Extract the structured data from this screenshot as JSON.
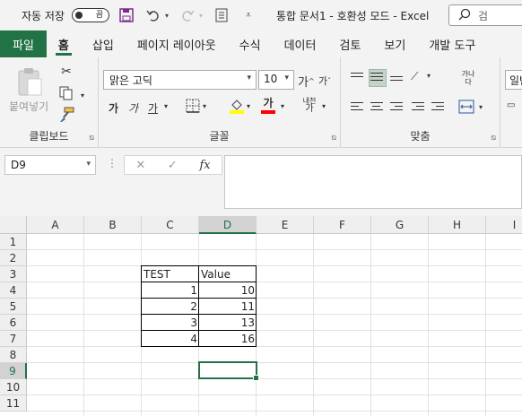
{
  "titlebar": {
    "autosave_label": "자동 저장",
    "autosave_state": "끔",
    "doc_title": "통합 문서1  -  호환성 모드  -  Excel",
    "search_placeholder": "검"
  },
  "tabs": [
    "파일",
    "홈",
    "삽입",
    "페이지 레이아웃",
    "수식",
    "데이터",
    "검토",
    "보기",
    "개발 도구"
  ],
  "ribbon": {
    "clipboard": {
      "paste_label": "붙여넣기",
      "group_label": "클립보드"
    },
    "font": {
      "font_name": "맑은 고딕",
      "font_size": "10",
      "grow_label": "가",
      "shrink_label": "가",
      "bold_label": "가",
      "italic_label": "가",
      "underline_label": "가",
      "font_color_label": "가",
      "phonetic_label": "내천",
      "group_label": "글꼴",
      "fill_color": "#ffff00",
      "font_color": "#ff0000"
    },
    "alignment": {
      "wrap_label": "가나 다",
      "group_label": "맞춤"
    },
    "number": {
      "format_value": "일반"
    }
  },
  "formula_bar": {
    "name_box": "D9",
    "cancel_icon": "close-icon",
    "enter_icon": "check-icon",
    "fx_label": "fx",
    "formula": ""
  },
  "sheet": {
    "columns": [
      "A",
      "B",
      "C",
      "D",
      "E",
      "F",
      "G",
      "H",
      "I"
    ],
    "rows": [
      "1",
      "2",
      "3",
      "4",
      "5",
      "6",
      "7",
      "8",
      "9",
      "10",
      "11"
    ],
    "selected_cell": "D9",
    "cells": {
      "C3": "TEST",
      "D3": "Value",
      "C4": "1",
      "D4": "10",
      "C5": "2",
      "D5": "11",
      "C6": "3",
      "D6": "13",
      "C7": "4",
      "D7": "16"
    },
    "accent_color": "#217346"
  }
}
